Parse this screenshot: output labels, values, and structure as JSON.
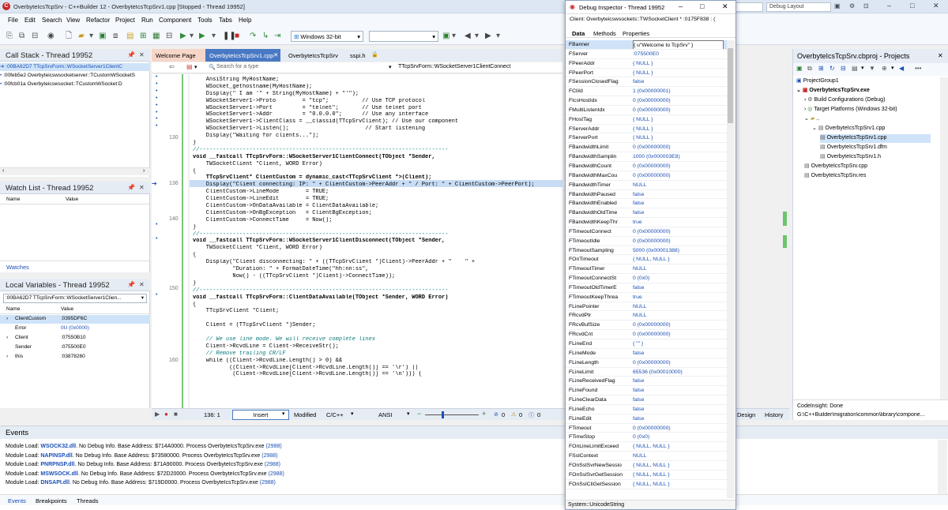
{
  "window": {
    "title": "OverbyteIcsTcpSrv - C++Builder 12 - OverbyteIcsTcpSrv1.cpp [Stopped - Thread 19952]",
    "layout": "Debug Layout"
  },
  "menu": [
    "File",
    "Edit",
    "Search",
    "View",
    "Refactor",
    "Project",
    "Run",
    "Component",
    "Tools",
    "Tabs",
    "Help"
  ],
  "toolbar": {
    "platform": "Windows 32-bit"
  },
  "call_stack": {
    "title": "Call Stack - Thread 19952",
    "items": [
      ":00BA62D7 TTcpSrvForm::WSocketServer1ClientC",
      ":00feb5e2 Overbyteicswsocketserver::TCustomWSocketS",
      ":00fcb01a Overbyteicswsocket::TCustomWSocket:D"
    ]
  },
  "watch": {
    "title": "Watch List - Thread 19952",
    "col_name": "Name",
    "col_value": "Value",
    "tab": "Watches"
  },
  "locals": {
    "title": "Local Variables - Thread 19952",
    "selector": ":00BA62D7 TTcpSrvForm::WSocketServer1Clien...",
    "col_name": "Name",
    "col_value": "Value",
    "rows": [
      {
        "name": "ClientCustom",
        "value": ":0395DF6C"
      },
      {
        "name": "Error",
        "value": "0U (0x0000)"
      },
      {
        "name": "Client",
        "value": ":07550B10"
      },
      {
        "name": "Sender",
        "value": ":075500E0"
      },
      {
        "name": "this",
        "value": ":03878260"
      }
    ]
  },
  "tabs": [
    "Welcome Page",
    "OverbyteIcsTcpSrv1.cpp",
    "OverbyteIcsTcpSrv",
    "sspi.h"
  ],
  "editor": {
    "search_placeholder": "Search for a type",
    "nav": "TTcpSrvForm::WSocketServer1ClientConnect",
    "position": "136: 1",
    "mode": "Insert",
    "modified": "Modified",
    "lang": "C/C++",
    "encoding": "ANSI",
    "design": "Design",
    "history": "History",
    "counts": [
      "0",
      "0",
      "0"
    ],
    "line_numbers": {
      "l130": "130",
      "l136": "136",
      "l140": "140",
      "l150": "150",
      "l160": "160"
    }
  },
  "code": [
    "    AnsiString MyHostName;",
    "    WSocket_gethostname(MyHostName);",
    "    Display(\" I am '\" + String(MyHostName) + \"'\");",
    "    WSocketServer1->Proto        = \"tcp\";          // Use TCP protocol",
    "    WSocketServer1->Port         = \"telnet\";       // Use telnet port",
    "    WSocketServer1->Addr         = \"0.0.0.0\";      // Use any interface",
    "    WSocketServer1->ClientClass = __classid(TTcpSrvClient); // Use our component",
    "    WSocketServer1->Listen();                       // Start listening",
    "    Display(\"Waiting for clients...\");",
    "}",
    "//---------------------------------------------------------------------------",
    "void __fastcall TTcpSrvForm::WSocketServer1ClientConnect(TObject *Sender,",
    "    TWSocketClient *Client, WORD Error)",
    "{",
    "    TTcpSrvClient* ClientCustom = dynamic_cast<TTcpSrvClient *>(Client);",
    "    Display(\"Client connecting: IP: \" + ClientCustom->PeerAddr + \" / Port: \" + ClientCustom->PeerPort);",
    "    ClientCustom->LineMode        = TRUE;",
    "    ClientCustom->LineEdit        = TRUE;",
    "    ClientCustom->OnDataAvailable = ClientDataAvailable;",
    "    ClientCustom->OnBgException   = ClientBgException;",
    "    ClientCustom->ConnectTime     = Now();",
    "}",
    "//---------------------------------------------------------------------------",
    "void __fastcall TTcpSrvForm::WSocketServer1ClientDisconnect(TObject *Sender,",
    "    TWSocketClient *Client, WORD Error)",
    "{",
    "    Display(\"Client disconnecting: \" + ((TTcpSrvClient *)Client)->PeerAddr + \"    \" +",
    "            \"Duration: \" + FormatDateTime(\"hh:nn:ss\",",
    "            Now() - ((TTcpSrvClient *)Client)->ConnectTime));",
    "}",
    "//---------------------------------------------------------------------------",
    "void __fastcall TTcpSrvForm::ClientDataAvailable(TObject *Sender, WORD Error)",
    "{",
    "    TTcpSrvClient *Client;",
    "",
    "    Client = (TTcpSrvClient *)Sender;",
    "",
    "    // We use line mode. We will receive complete lines",
    "    Client->RcvdLine = Client->ReceiveStr();",
    "    // Remove trailing CR/LF",
    "    while ((Client->RcvdLine.Length() > 0) &&",
    "           ((Client->RcvdLine[Client->RcvdLine.Length()] == '\\r') ||",
    "            (Client->RcvdLine[Client->RcvdLine.Length()] == '\\n'))) {"
  ],
  "inspector": {
    "title": "Debug Inspector - Thread 19952",
    "client": "Client: Overbyteicswsockets::TWSocketClient * :0175F838 : (",
    "tabs": [
      "Data",
      "Methods",
      "Properties"
    ],
    "status": "System::UnicodeString",
    "props": [
      {
        "name": "FBanner",
        "value": "{ u\"Welcome to TcpSrv\" }"
      },
      {
        "name": "FServer",
        "value": ":075500E0"
      },
      {
        "name": "FPeerAddr",
        "value": "{ NULL }"
      },
      {
        "name": "FPeerPort",
        "value": "{ NULL }"
      },
      {
        "name": "FSessionClosedFlag",
        "value": "false"
      },
      {
        "name": "FCliId",
        "value": "1 (0x00000001)"
      },
      {
        "name": "FIcsHostIdx",
        "value": "0 (0x00000000)"
      },
      {
        "name": "FMultiListenIdx",
        "value": "0 (0x00000000)"
      },
      {
        "name": "FHostTag",
        "value": "{ NULL }"
      },
      {
        "name": "FServerAddr",
        "value": "{ NULL }"
      },
      {
        "name": "FServerPort",
        "value": "{ NULL }"
      },
      {
        "name": "FBandwidthLimit",
        "value": "0 (0x00000000)"
      },
      {
        "name": "FBandwidthSamplin",
        "value": "1000 (0x000003E8)"
      },
      {
        "name": "FBandwidthCount",
        "value": "0 (0x00000000)"
      },
      {
        "name": "FBandwidthMaxCou",
        "value": "0 (0x00000000)"
      },
      {
        "name": "FBandwidthTimer",
        "value": "NULL"
      },
      {
        "name": "FBandwidthPaused",
        "value": "false"
      },
      {
        "name": "FBandwidthEnabled",
        "value": "false"
      },
      {
        "name": "FBandwidthOldTime",
        "value": "false"
      },
      {
        "name": "FBandwidthKeepThr",
        "value": "true"
      },
      {
        "name": "FTimeoutConnect",
        "value": "0 (0x00000000)"
      },
      {
        "name": "FTimeoutIdle",
        "value": "0 (0x00000000)"
      },
      {
        "name": "FTimeoutSampling",
        "value": "5000 (0x00001388)"
      },
      {
        "name": "FOnTimeout",
        "value": "{ NULL, NULL }"
      },
      {
        "name": "FTimeoutTimer",
        "value": "NULL"
      },
      {
        "name": "FTimeoutConnectSt",
        "value": "0 (0x0)"
      },
      {
        "name": "FTimeoutOldTimerE",
        "value": "false"
      },
      {
        "name": "FTimeoutKeepThrea",
        "value": "true"
      },
      {
        "name": "FLinePointer",
        "value": "NULL"
      },
      {
        "name": "FRcvdPtr",
        "value": "NULL"
      },
      {
        "name": "FRcvBufSize",
        "value": "0 (0x00000000)"
      },
      {
        "name": "FRcvdCnt",
        "value": "0 (0x00000000)"
      },
      {
        "name": "FLineEnd",
        "value": "{ \"\" }"
      },
      {
        "name": "FLineMode",
        "value": "false"
      },
      {
        "name": "FLineLength",
        "value": "0 (0x00000000)"
      },
      {
        "name": "FLineLimit",
        "value": "65536 (0x00010000)"
      },
      {
        "name": "FLineReceivedFlag",
        "value": "false"
      },
      {
        "name": "FLineFound",
        "value": "false"
      },
      {
        "name": "FLineClearData",
        "value": "false"
      },
      {
        "name": "FLineEcho",
        "value": "false"
      },
      {
        "name": "FLineEdit",
        "value": "false"
      },
      {
        "name": "FTimeout",
        "value": "0 (0x00000000)"
      },
      {
        "name": "FTimeStop",
        "value": "0 (0x0)"
      },
      {
        "name": "FOnLineLimitExceed",
        "value": "{ NULL, NULL }"
      },
      {
        "name": "FSslContext",
        "value": "NULL"
      },
      {
        "name": "FOnSslSvrNewSessio",
        "value": "{ NULL, NULL }"
      },
      {
        "name": "FOnSslSvrGetSession",
        "value": "{ NULL, NULL }"
      },
      {
        "name": "FOnSslCliGetSession",
        "value": "{ NULL, NULL }"
      }
    ]
  },
  "project": {
    "title": "OverbyteIcsTcpSrv.cbproj - Projects",
    "tree": [
      {
        "label": "ProjectGroup1",
        "level": 0,
        "bold": false,
        "sel": false
      },
      {
        "label": "OverbyteIcsTcpSrv.exe",
        "level": 1,
        "bold": true,
        "sel": false
      },
      {
        "label": "Build Configurations (Debug)",
        "level": 2,
        "bold": false,
        "sel": false
      },
      {
        "label": "Target Platforms (Windows 32-bit)",
        "level": 2,
        "bold": false,
        "sel": false
      },
      {
        "label": "..",
        "level": 2,
        "bold": false,
        "sel": false
      },
      {
        "label": "OverbyteIcsTcpSrv1.cpp",
        "level": 3,
        "bold": false,
        "sel": false
      },
      {
        "label": "OverbyteIcsTcpSrv1.cpp",
        "level": 4,
        "bold": false,
        "sel": true
      },
      {
        "label": "OverbyteIcsTcpSrv1.dfm",
        "level": 4,
        "bold": false,
        "sel": false
      },
      {
        "label": "OverbyteIcsTcpSrv1.h",
        "level": 4,
        "bold": false,
        "sel": false
      },
      {
        "label": "OverbyteIcsTcpSrv.cpp",
        "level": 2,
        "bold": false,
        "sel": false
      },
      {
        "label": "OverbyteIcsTcpSrv.res",
        "level": 2,
        "bold": false,
        "sel": false
      }
    ],
    "codeinsight": "CodeInsight: Done",
    "path": "G:\\C++Builder\\migration\\common\\library\\compone..."
  },
  "events": {
    "title": "Events",
    "lines": [
      {
        "prefix": "Module Load: ",
        "dll": "WSOCK32.dll",
        "rest": ". No Debug Info. Base Address: $714A0000. Process OverbyteIcsTcpSrv.exe ",
        "pid": "(2988)"
      },
      {
        "prefix": "Module Load: ",
        "dll": "NAPINSP.dll",
        "rest": ". No Debug Info. Base Address: $73580000. Process OverbyteIcsTcpSrv.exe ",
        "pid": "(2988)"
      },
      {
        "prefix": "Module Load: ",
        "dll": "PNRPNSP.dll",
        "rest": ". No Debug Info. Base Address: $71A90000. Process OverbyteIcsTcpSrv.exe ",
        "pid": "(2988)"
      },
      {
        "prefix": "Module Load: ",
        "dll": "MSWSOCK.dll",
        "rest": ". No Debug Info. Base Address: $72D20000. Process OverbyteIcsTcpSrv.exe ",
        "pid": "(2988)"
      },
      {
        "prefix": "Module Load: ",
        "dll": "DNSAPI.dll",
        "rest": ". No Debug Info. Base Address: $719D0000. Process OverbyteIcsTcpSrv.exe ",
        "pid": "(2988)"
      }
    ],
    "tabs": [
      "Events",
      "Breakpoints",
      "Threads"
    ]
  }
}
